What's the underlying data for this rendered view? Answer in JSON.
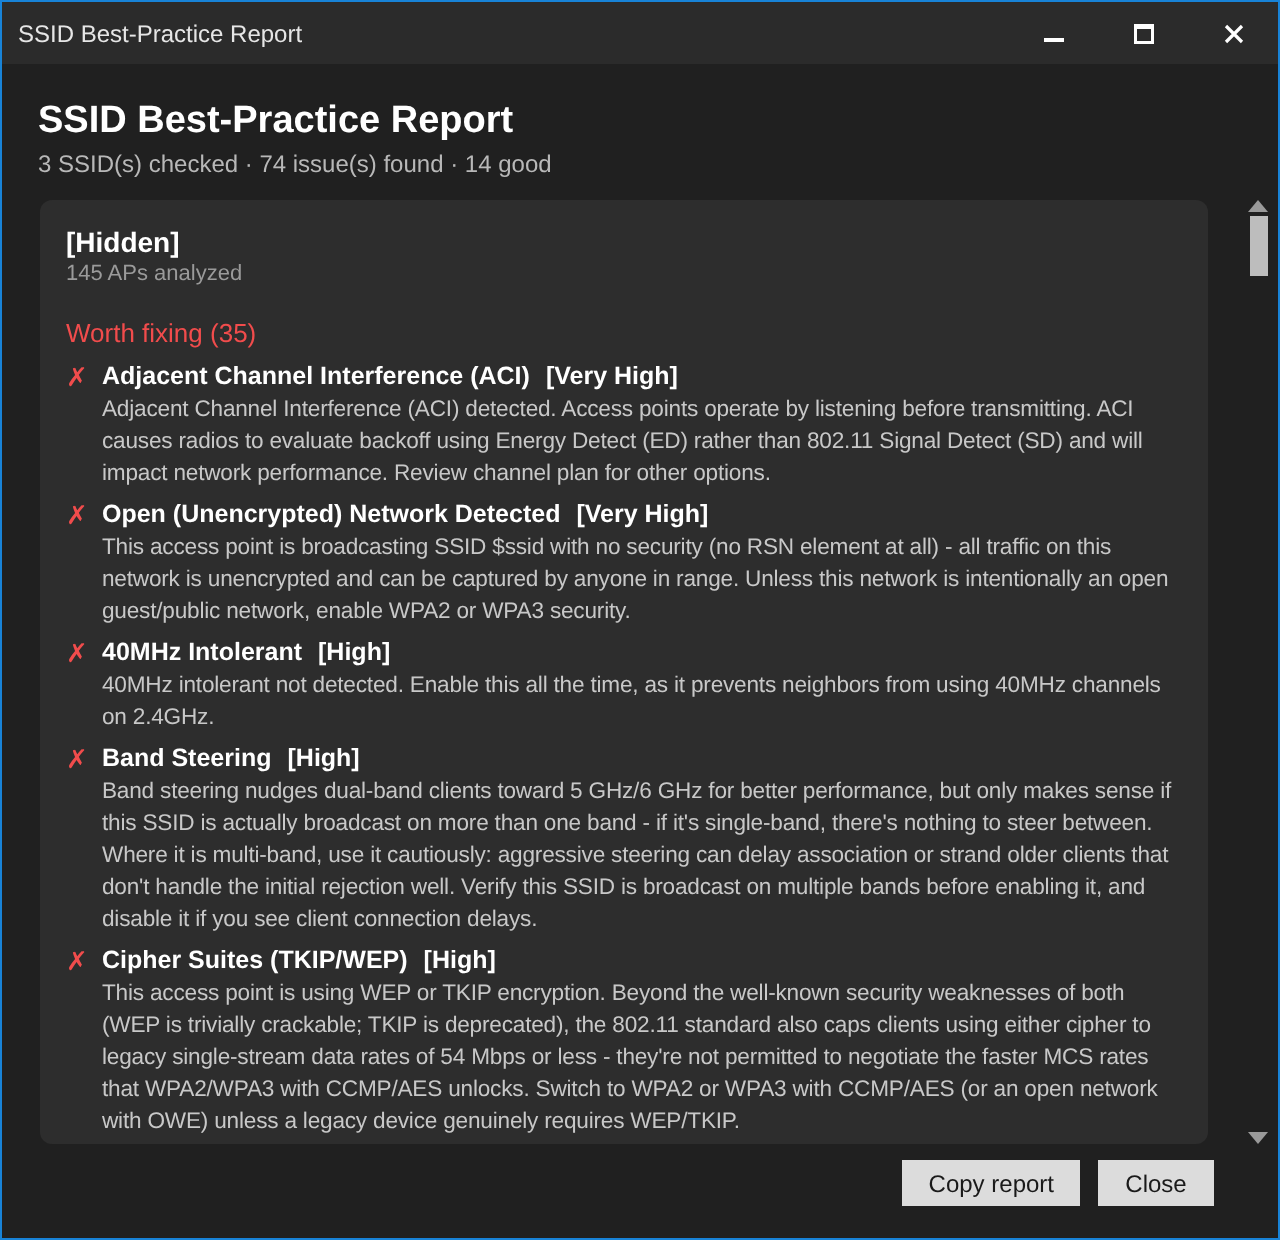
{
  "window": {
    "title": "SSID Best-Practice Report"
  },
  "header": {
    "title": "SSID Best-Practice Report",
    "summary": "3 SSID(s) checked · 74 issue(s) found · 14 good"
  },
  "ssid": {
    "name": "[Hidden]",
    "subtitle": "145 APs analyzed",
    "sections": [
      {
        "kind": "fix",
        "title": "Worth fixing (35)",
        "issues": [
          {
            "mark": "✗",
            "title": "Adjacent Channel Interference (ACI)",
            "severity": "[Very High]",
            "description": "Adjacent Channel Interference (ACI) detected. Access points operate by listening before transmitting. ACI causes radios to evaluate backoff using Energy Detect (ED) rather than 802.11 Signal Detect (SD) and will impact network performance. Review channel plan for other options."
          },
          {
            "mark": "✗",
            "title": "Open (Unencrypted) Network Detected",
            "severity": "[Very High]",
            "description": "This access point is broadcasting SSID $ssid with no security (no RSN element at all) - all traffic on this network is unencrypted and can be captured by anyone in range. Unless this network is intentionally an open guest/public network, enable WPA2 or WPA3 security."
          },
          {
            "mark": "✗",
            "title": "40MHz Intolerant",
            "severity": "[High]",
            "description": "40MHz intolerant not detected. Enable this all the time, as it prevents neighbors from using 40MHz channels on 2.4GHz."
          },
          {
            "mark": "✗",
            "title": "Band Steering",
            "severity": "[High]",
            "description": "Band steering nudges dual-band clients toward 5 GHz/6 GHz for better performance, but only makes sense if this SSID is actually broadcast on more than one band - if it's single-band, there's nothing to steer between. Where it is multi-band, use it cautiously: aggressive steering can delay association or strand older clients that don't handle the initial rejection well. Verify this SSID is broadcast on multiple bands before enabling it, and disable it if you see client connection delays."
          },
          {
            "mark": "✗",
            "title": "Cipher Suites (TKIP/WEP)",
            "severity": "[High]",
            "description": "This access point is using WEP or TKIP encryption. Beyond the well-known security weaknesses of both (WEP is trivially crackable; TKIP is deprecated), the 802.11 standard also caps clients using either cipher to legacy single-stream data rates of 54 Mbps or less - they're not permitted to negotiate the faster MCS rates that WPA2/WPA3 with CCMP/AES unlocks. Switch to WPA2 or WPA3 with CCMP/AES (or an open network with OWE) unless a legacy device genuinely requires WEP/TKIP."
          }
        ]
      }
    ]
  },
  "buttons": [
    {
      "label": "Copy report"
    },
    {
      "label": "Close"
    }
  ]
}
